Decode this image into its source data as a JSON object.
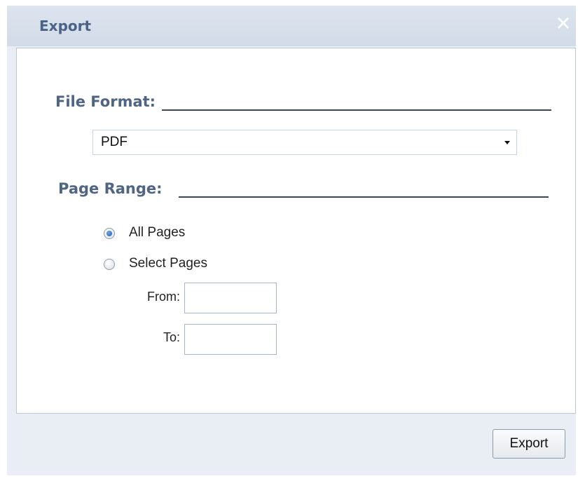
{
  "dialog": {
    "title": "Export",
    "close_glyph": "✕"
  },
  "file_format": {
    "label": "File Format:",
    "selected": "PDF"
  },
  "page_range": {
    "label": "Page Range:",
    "options": [
      {
        "label": "All Pages",
        "checked": true
      },
      {
        "label": "Select Pages",
        "checked": false
      }
    ],
    "from_label": "From:",
    "to_label": "To:",
    "from_value": "",
    "to_value": ""
  },
  "footer": {
    "export_label": "Export"
  },
  "colors": {
    "accent": "#4f6584",
    "dialog_bg": "#e9edf4"
  }
}
